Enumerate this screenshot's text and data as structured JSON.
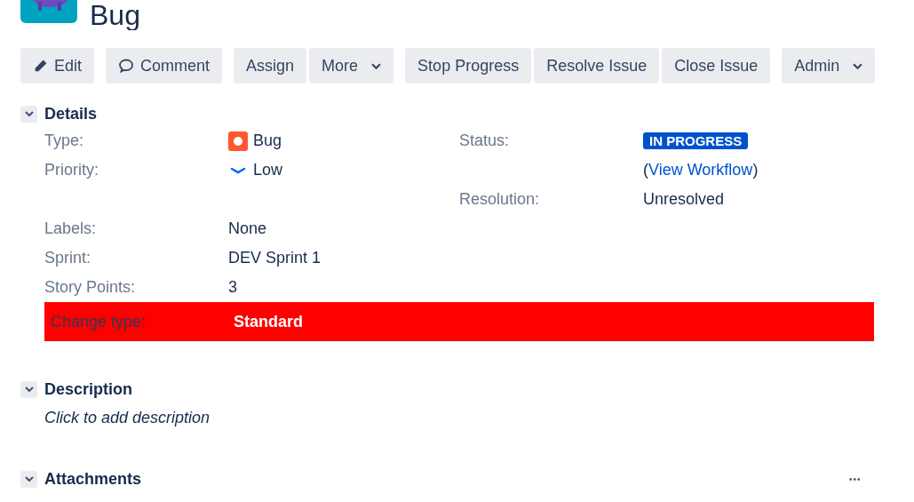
{
  "issue": {
    "title": "Bug"
  },
  "toolbar": [
    {
      "groups": [
        {
          "label": "Edit",
          "kind": "pencil"
        }
      ]
    },
    {
      "groups": [
        {
          "label": "Comment",
          "kind": "comment"
        }
      ]
    },
    {
      "groups": [
        {
          "label": "Assign"
        },
        {
          "label": "More",
          "dropdown": true
        }
      ]
    },
    {
      "groups": [
        {
          "label": "Stop Progress"
        },
        {
          "label": "Resolve Issue"
        },
        {
          "label": "Close Issue"
        }
      ]
    },
    {
      "groups": [
        {
          "label": "Admin",
          "dropdown": true
        }
      ]
    }
  ],
  "details": {
    "title": "Details",
    "expanded": true,
    "left": [
      {
        "label": "Type:",
        "value": "Bug",
        "kind": "bug"
      },
      {
        "label": "Priority:",
        "value": "Low",
        "kind": "low"
      }
    ],
    "right": [
      {
        "label": "Status:",
        "kind": "status",
        "value": "IN PROGRESS",
        "link_before": "(",
        "link": "View Workflow",
        "link_after": ")"
      },
      {
        "label": "Resolution:",
        "kind": "text",
        "value": "Unresolved"
      }
    ],
    "rows": [
      {
        "label": "Labels:",
        "value": "None",
        "highlighted": false
      },
      {
        "label": "Sprint:",
        "value": "DEV Sprint 1",
        "highlighted": false
      },
      {
        "label": "Story Points:",
        "value": "3",
        "highlighted": false
      },
      {
        "label": "Change type:",
        "value": "Standard",
        "highlighted": true
      }
    ]
  },
  "description": {
    "title": "Description",
    "expanded": true,
    "placeholder": "Click to add description"
  },
  "attachments": {
    "title": "Attachments",
    "expanded": true,
    "menu": "•••"
  }
}
